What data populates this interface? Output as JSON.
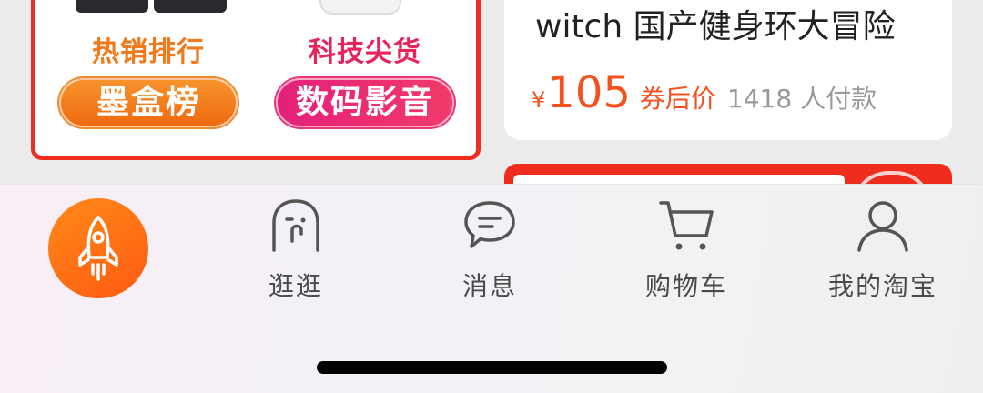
{
  "promo": {
    "left": {
      "subtitle": "热销排行",
      "pill": "墨盒榜"
    },
    "right": {
      "subtitle": "科技尖货",
      "pill": "数码影音"
    }
  },
  "product": {
    "title": "witch 国产健身环大冒险",
    "currency": "¥",
    "price": "105",
    "coupon_label": "券后价",
    "sold": "1418 人付款"
  },
  "tabbar": {
    "home": {
      "icon": "rocket-icon"
    },
    "tabs": [
      {
        "label": "逛逛",
        "icon": "ghost-face-icon"
      },
      {
        "label": "消息",
        "icon": "chat-bubble-icon"
      },
      {
        "label": "购物车",
        "icon": "shopping-cart-icon"
      },
      {
        "label": "我的淘宝",
        "icon": "person-icon"
      }
    ]
  },
  "colors": {
    "accent": "#f4511e",
    "promo_border": "#ee2d1f",
    "home_button": "#ff6a10"
  }
}
